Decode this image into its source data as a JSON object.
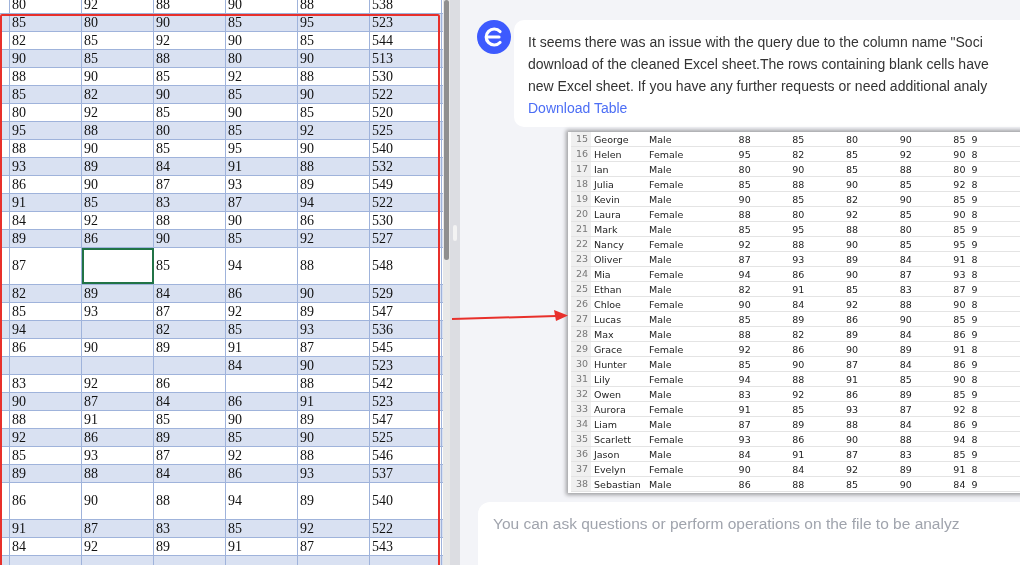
{
  "sheet": {
    "rows": [
      {
        "tall": false,
        "cells": [
          "80",
          "92",
          "88",
          "90",
          "88",
          "538"
        ]
      },
      {
        "tall": false,
        "cells": [
          "85",
          "80",
          "90",
          "85",
          "95",
          "523"
        ]
      },
      {
        "tall": false,
        "cells": [
          "82",
          "85",
          "92",
          "90",
          "85",
          "544"
        ]
      },
      {
        "tall": false,
        "cells": [
          "90",
          "85",
          "88",
          "80",
          "90",
          "513"
        ]
      },
      {
        "tall": false,
        "cells": [
          "88",
          "90",
          "85",
          "92",
          "88",
          "530"
        ]
      },
      {
        "tall": false,
        "cells": [
          "85",
          "82",
          "90",
          "85",
          "90",
          "522"
        ]
      },
      {
        "tall": false,
        "cells": [
          "80",
          "92",
          "85",
          "90",
          "85",
          "520"
        ]
      },
      {
        "tall": false,
        "cells": [
          "95",
          "88",
          "80",
          "85",
          "92",
          "525"
        ]
      },
      {
        "tall": false,
        "cells": [
          "88",
          "90",
          "85",
          "95",
          "90",
          "540"
        ]
      },
      {
        "tall": false,
        "cells": [
          "93",
          "89",
          "84",
          "91",
          "88",
          "532"
        ]
      },
      {
        "tall": false,
        "cells": [
          "86",
          "90",
          "87",
          "93",
          "89",
          "549"
        ]
      },
      {
        "tall": false,
        "cells": [
          "91",
          "85",
          "83",
          "87",
          "94",
          "522"
        ]
      },
      {
        "tall": false,
        "cells": [
          "84",
          "92",
          "88",
          "90",
          "86",
          "530"
        ]
      },
      {
        "tall": false,
        "cells": [
          "89",
          "86",
          "90",
          "85",
          "92",
          "527"
        ]
      },
      {
        "tall": true,
        "cells": [
          "87",
          {
            "selected": true
          },
          "85",
          "94",
          "88",
          "548"
        ]
      },
      {
        "tall": false,
        "cells": [
          "82",
          "89",
          "84",
          "86",
          "90",
          "529"
        ]
      },
      {
        "tall": false,
        "cells": [
          "85",
          "93",
          "87",
          "92",
          "89",
          "547"
        ]
      },
      {
        "tall": false,
        "cells": [
          "94",
          null,
          "82",
          "85",
          "93",
          "536"
        ]
      },
      {
        "tall": false,
        "cells": [
          "86",
          "90",
          "89",
          "91",
          "87",
          "545"
        ]
      },
      {
        "tall": false,
        "cells": [
          null,
          null,
          null,
          "84",
          "90",
          "523"
        ]
      },
      {
        "tall": false,
        "cells": [
          "83",
          "92",
          "86",
          null,
          "88",
          "542"
        ]
      },
      {
        "tall": false,
        "cells": [
          "90",
          "87",
          "84",
          "86",
          "91",
          "523"
        ]
      },
      {
        "tall": false,
        "cells": [
          "88",
          "91",
          "85",
          "90",
          "89",
          "547"
        ]
      },
      {
        "tall": false,
        "cells": [
          "92",
          "86",
          "89",
          "85",
          "90",
          "525"
        ]
      },
      {
        "tall": false,
        "cells": [
          "85",
          "93",
          "87",
          "92",
          "88",
          "546"
        ]
      },
      {
        "tall": false,
        "cells": [
          "89",
          "88",
          "84",
          "86",
          "93",
          "537"
        ]
      },
      {
        "tall": true,
        "cells": [
          "86",
          "90",
          "88",
          "94",
          "89",
          "540"
        ]
      },
      {
        "tall": false,
        "cells": [
          "91",
          "87",
          "83",
          "85",
          "92",
          "522"
        ]
      },
      {
        "tall": false,
        "cells": [
          "84",
          "92",
          "89",
          "91",
          "87",
          "543"
        ]
      },
      {
        "tall": false,
        "cells": [
          null,
          null,
          null,
          null,
          null,
          null
        ]
      }
    ]
  },
  "chat": {
    "message": {
      "lines": [
        "It seems there was an issue with the query due to the column name \"Soci",
        "download of the cleaned Excel sheet.The rows containing blank cells have",
        "new Excel sheet. If you have any further requests or need additional analy"
      ],
      "link": "Download Table"
    },
    "table_image": {
      "rows": [
        {
          "number": "15",
          "name": "George",
          "gender": "Male",
          "scores": [
            "88",
            "85",
            "80",
            "90",
            "85",
            "9"
          ]
        },
        {
          "number": "16",
          "name": "Helen",
          "gender": "Female",
          "scores": [
            "95",
            "82",
            "85",
            "92",
            "90",
            "8"
          ]
        },
        {
          "number": "17",
          "name": "Ian",
          "gender": "Male",
          "scores": [
            "80",
            "90",
            "85",
            "88",
            "80",
            "9"
          ]
        },
        {
          "number": "18",
          "name": "Julia",
          "gender": "Female",
          "scores": [
            "85",
            "88",
            "90",
            "85",
            "92",
            "8"
          ]
        },
        {
          "number": "19",
          "name": "Kevin",
          "gender": "Male",
          "scores": [
            "90",
            "85",
            "82",
            "90",
            "85",
            "9"
          ]
        },
        {
          "number": "20",
          "name": "Laura",
          "gender": "Female",
          "scores": [
            "88",
            "80",
            "92",
            "85",
            "90",
            "8"
          ]
        },
        {
          "number": "21",
          "name": "Mark",
          "gender": "Male",
          "scores": [
            "85",
            "95",
            "88",
            "80",
            "85",
            "9"
          ]
        },
        {
          "number": "22",
          "name": "Nancy",
          "gender": "Female",
          "scores": [
            "92",
            "88",
            "90",
            "85",
            "95",
            "9"
          ]
        },
        {
          "number": "23",
          "name": "Oliver",
          "gender": "Male",
          "scores": [
            "87",
            "93",
            "89",
            "84",
            "91",
            "8"
          ]
        },
        {
          "number": "24",
          "name": "Mia",
          "gender": "Female",
          "scores": [
            "94",
            "86",
            "90",
            "87",
            "93",
            "8"
          ]
        },
        {
          "number": "25",
          "name": "Ethan",
          "gender": "Male",
          "scores": [
            "82",
            "91",
            "85",
            "83",
            "87",
            "9"
          ]
        },
        {
          "number": "26",
          "name": "Chloe",
          "gender": "Female",
          "scores": [
            "90",
            "84",
            "92",
            "88",
            "90",
            "8"
          ]
        },
        {
          "number": "27",
          "name": "Lucas",
          "gender": "Male",
          "scores": [
            "85",
            "89",
            "86",
            "90",
            "85",
            "9"
          ]
        },
        {
          "number": "28",
          "name": "Max",
          "gender": "Male",
          "scores": [
            "88",
            "82",
            "89",
            "84",
            "86",
            "9"
          ]
        },
        {
          "number": "29",
          "name": "Grace",
          "gender": "Female",
          "scores": [
            "92",
            "86",
            "90",
            "89",
            "91",
            "8"
          ]
        },
        {
          "number": "30",
          "name": "Hunter",
          "gender": "Male",
          "scores": [
            "85",
            "90",
            "87",
            "84",
            "86",
            "9"
          ]
        },
        {
          "number": "31",
          "name": "Lily",
          "gender": "Female",
          "scores": [
            "94",
            "88",
            "91",
            "85",
            "90",
            "8"
          ]
        },
        {
          "number": "32",
          "name": "Owen",
          "gender": "Male",
          "scores": [
            "83",
            "92",
            "86",
            "89",
            "85",
            "9"
          ]
        },
        {
          "number": "33",
          "name": "Aurora",
          "gender": "Female",
          "scores": [
            "91",
            "85",
            "93",
            "87",
            "92",
            "8"
          ]
        },
        {
          "number": "34",
          "name": "Liam",
          "gender": "Male",
          "scores": [
            "87",
            "89",
            "88",
            "84",
            "86",
            "9"
          ]
        },
        {
          "number": "35",
          "name": "Scarlett",
          "gender": "Female",
          "scores": [
            "93",
            "86",
            "90",
            "88",
            "94",
            "8"
          ]
        },
        {
          "number": "36",
          "name": "Jason",
          "gender": "Male",
          "scores": [
            "84",
            "91",
            "87",
            "83",
            "85",
            "9"
          ]
        },
        {
          "number": "37",
          "name": "Evelyn",
          "gender": "Female",
          "scores": [
            "90",
            "84",
            "92",
            "89",
            "91",
            "8"
          ]
        },
        {
          "number": "38",
          "name": "Sebastian",
          "gender": "Male",
          "scores": [
            "86",
            "88",
            "85",
            "90",
            "84",
            "9"
          ]
        }
      ]
    },
    "input": {
      "placeholder": "You can ask questions or perform operations on the file to be analyz"
    }
  }
}
